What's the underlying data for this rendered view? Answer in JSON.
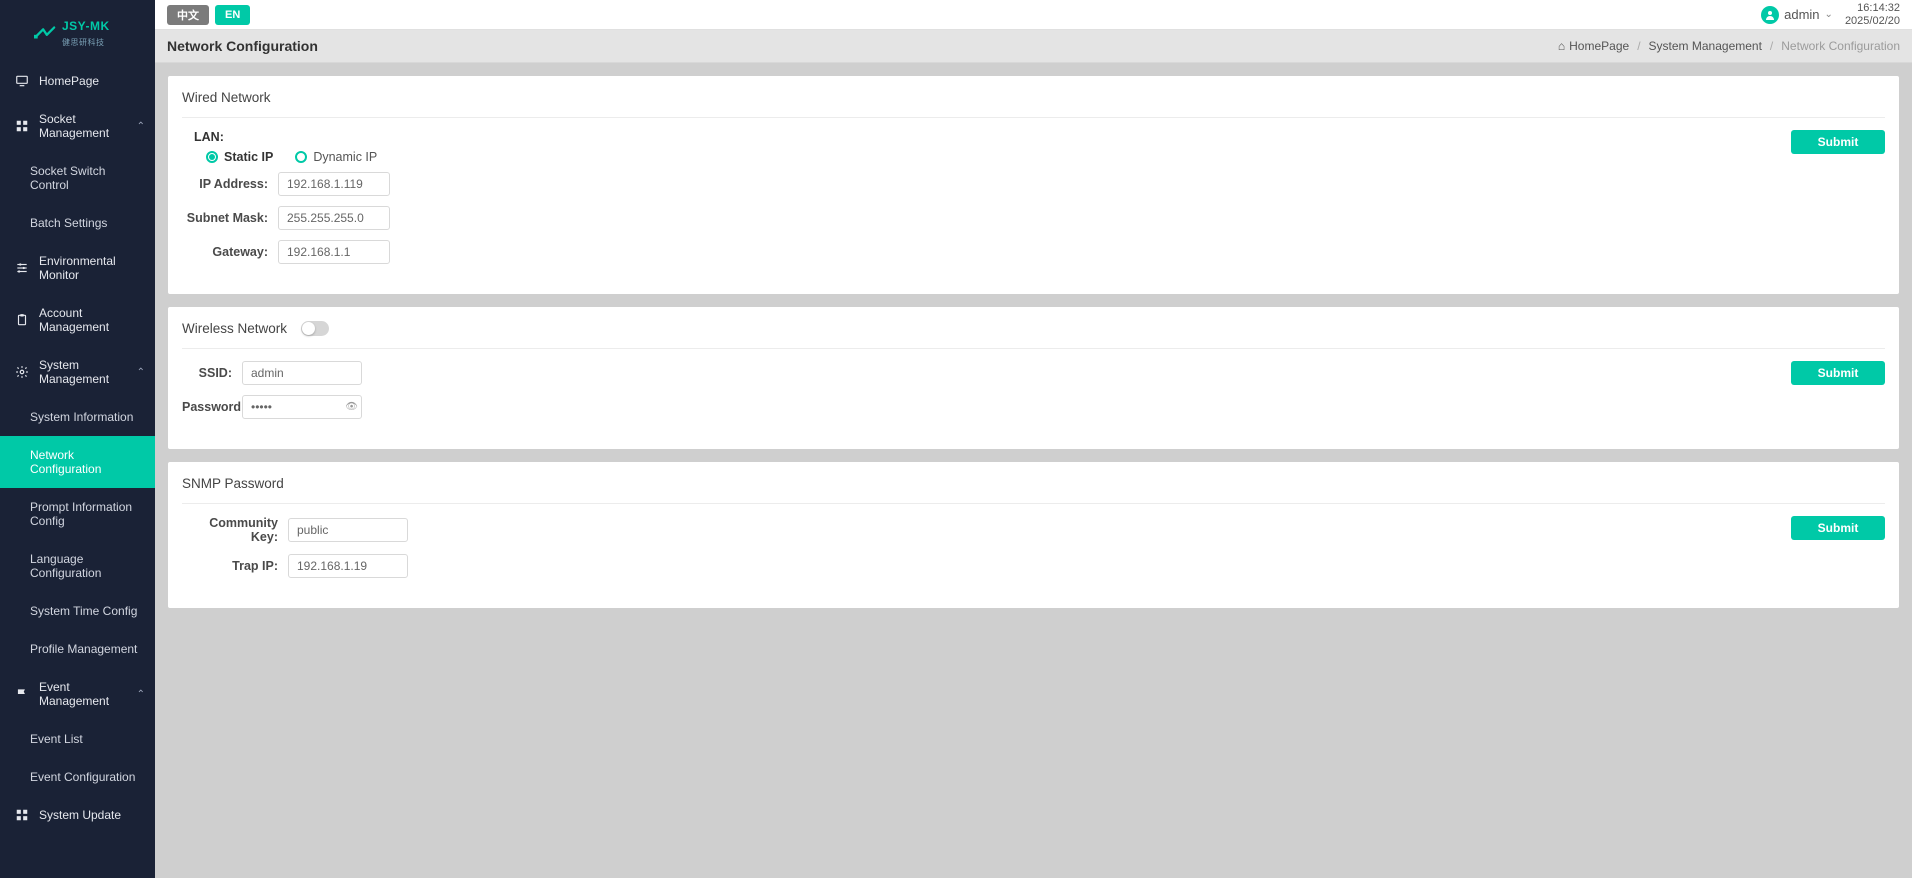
{
  "brand": {
    "name": "JSY-MK",
    "sub": "健思研科技"
  },
  "topbar": {
    "lang_zh": "中文",
    "lang_en": "EN",
    "user": "admin",
    "time": "16:14:32",
    "date": "2025/02/20"
  },
  "breadcrumb": {
    "title": "Network Configuration",
    "home": "HomePage",
    "mid": "System Management",
    "cur": "Network Configuration"
  },
  "sidebar": [
    {
      "label": "HomePage",
      "icon": "monitor"
    },
    {
      "label": "Socket Management",
      "icon": "grid",
      "expandable": true,
      "children": [
        {
          "label": "Socket Switch Control"
        },
        {
          "label": "Batch Settings"
        }
      ]
    },
    {
      "label": "Environmental Monitor",
      "icon": "sliders"
    },
    {
      "label": "Account Management",
      "icon": "clipboard"
    },
    {
      "label": "System Management",
      "icon": "gear",
      "expandable": true,
      "children": [
        {
          "label": "System Information"
        },
        {
          "label": "Network Configuration",
          "active": true
        },
        {
          "label": "Prompt Information Config"
        },
        {
          "label": "Language Configuration"
        },
        {
          "label": "System Time Config"
        },
        {
          "label": "Profile Management"
        }
      ]
    },
    {
      "label": "Event Management",
      "icon": "flag",
      "expandable": true,
      "children": [
        {
          "label": "Event List"
        },
        {
          "label": "Event Configuration"
        }
      ]
    },
    {
      "label": "System Update",
      "icon": "grid"
    }
  ],
  "wired": {
    "heading": "Wired Network",
    "lan_label": "LAN:",
    "static": "Static IP",
    "dynamic": "Dynamic IP",
    "ip_label": "IP Address:",
    "ip": "192.168.1.119",
    "mask_label": "Subnet Mask:",
    "mask": "255.255.255.0",
    "gw_label": "Gateway:",
    "gw": "192.168.1.1",
    "submit": "Submit"
  },
  "wireless": {
    "heading": "Wireless Network",
    "ssid_label": "SSID:",
    "ssid": "admin",
    "pw_label": "Password:",
    "pw": "•••••",
    "submit": "Submit"
  },
  "snmp": {
    "heading": "SNMP Password",
    "key_label": "Community Key:",
    "key": "public",
    "trap_label": "Trap IP:",
    "trap": "192.168.1.19",
    "submit": "Submit"
  }
}
